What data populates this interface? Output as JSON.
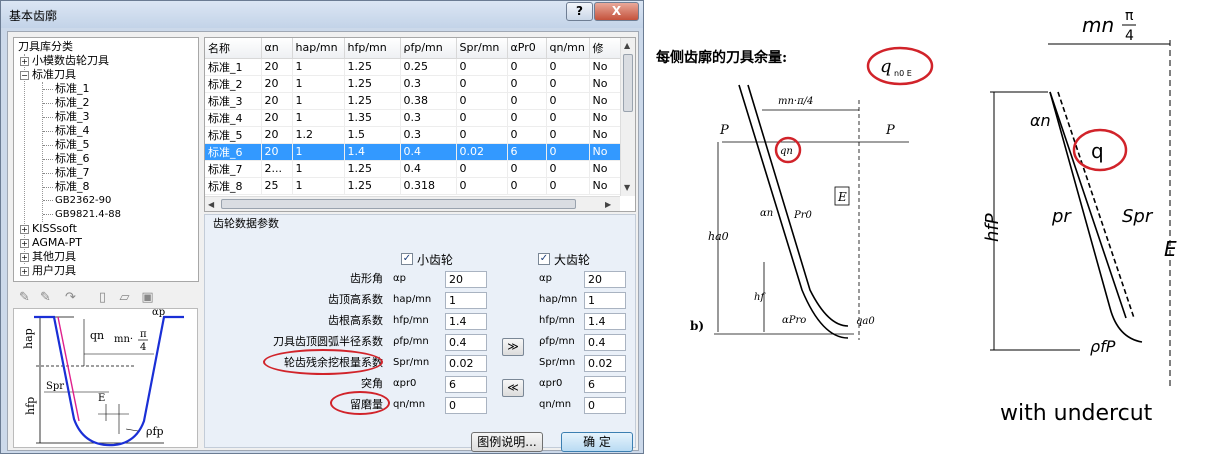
{
  "dialog": {
    "title": "基本齿廓",
    "help_label": "?",
    "close_label": "X",
    "ok_label": "确  定",
    "legend_label": "图例说明..."
  },
  "tree": {
    "root": "刀具库分类",
    "items": [
      {
        "label": "小模数齿轮刀具",
        "expander": "+"
      },
      {
        "label": "标准刀具",
        "expander": "−"
      },
      {
        "label": "KISSsoft",
        "expander": "+"
      },
      {
        "label": "AGMA-PT",
        "expander": "+"
      },
      {
        "label": "其他刀具",
        "expander": "+"
      },
      {
        "label": "用户刀具",
        "expander": "+"
      }
    ],
    "children": [
      "标准_1",
      "标准_2",
      "标准_3",
      "标准_4",
      "标准_5",
      "标准_6",
      "标准_7",
      "标准_8",
      "GB2362-90",
      "GB9821.4-88"
    ]
  },
  "table": {
    "headers": [
      "名称",
      "αn",
      "hap/mn",
      "hfp/mn",
      "ρfp/mn",
      "Spr/mn",
      "αPr0",
      "qn/mn",
      "修"
    ],
    "rows": [
      [
        "标准_1",
        "20",
        "1",
        "1.25",
        "0.25",
        "0",
        "0",
        "0",
        "No"
      ],
      [
        "标准_2",
        "20",
        "1",
        "1.25",
        "0.3",
        "0",
        "0",
        "0",
        "No"
      ],
      [
        "标准_3",
        "20",
        "1",
        "1.25",
        "0.38",
        "0",
        "0",
        "0",
        "No"
      ],
      [
        "标准_4",
        "20",
        "1",
        "1.35",
        "0.3",
        "0",
        "0",
        "0",
        "No"
      ],
      [
        "标准_5",
        "20",
        "1.2",
        "1.5",
        "0.3",
        "0",
        "0",
        "0",
        "No"
      ],
      [
        "标准_6",
        "20",
        "1",
        "1.4",
        "0.4",
        "0.02",
        "6",
        "0",
        "No"
      ],
      [
        "标准_7",
        "2...",
        "1",
        "1.25",
        "0.4",
        "0",
        "0",
        "0",
        "No"
      ],
      [
        "标准_8",
        "25",
        "1",
        "1.25",
        "0.318",
        "0",
        "0",
        "0",
        "No"
      ]
    ],
    "selected_row": 5
  },
  "params": {
    "group_title": "齿轮数据参数",
    "small_gear": "小齿轮",
    "large_gear": "大齿轮",
    "labels": [
      "齿形角",
      "齿顶高系数",
      "齿根高系数",
      "刀具齿顶圆弧半径系数",
      "轮齿残余挖根量系数",
      "突角",
      "留磨量"
    ],
    "symbols": [
      "αp",
      "hap/mn",
      "hfp/mn",
      "ρfp/mn",
      "Spr/mn",
      "αpr0",
      "qn/mn"
    ],
    "small_values": [
      "20",
      "1",
      "1.4",
      "0.4",
      "0.02",
      "6",
      "0"
    ],
    "large_values": [
      "20",
      "1",
      "1.4",
      "0.4",
      "0.02",
      "6",
      "0"
    ],
    "copy_right": "≫",
    "copy_left": "≪"
  },
  "diagram": {
    "hap": "hap",
    "hfp": "hfp",
    "spr": "Spr",
    "qn": "qn",
    "e": "E",
    "rho": "ρfp",
    "alpha": "αp",
    "pitch_num": "mn·",
    "pitch_frac_top": "π",
    "pitch_frac_bot": "4"
  },
  "scan1": {
    "heading": "每侧齿廓的刀具余量:",
    "q_mark": "q",
    "q_sub": "n0 E",
    "top": "mn·π/4",
    "p": "P",
    "qn": "qn",
    "alpha": "αn",
    "pr0": "Pr0",
    "e": "E",
    "ha0": "ha0",
    "hf": "hf",
    "apro": "αPro",
    "qa0": "qa0",
    "b": "b)"
  },
  "scan2": {
    "top_num": "mn",
    "top_pi": "π",
    "top_den": "4",
    "alpha": "αn",
    "q": "q",
    "pr": "pr",
    "spr": "Spr",
    "e": "E",
    "hfp": "hfP",
    "rho": "ρfP",
    "caption": "with undercut"
  }
}
